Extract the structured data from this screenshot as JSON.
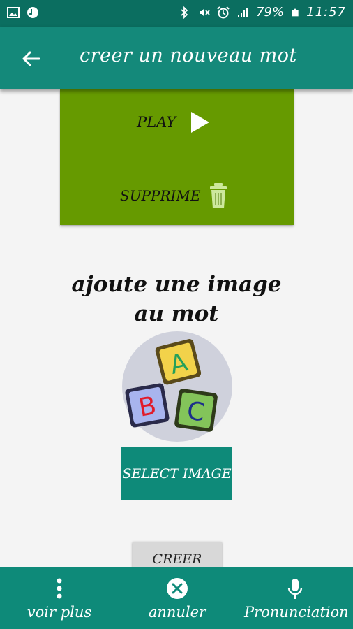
{
  "status_bar": {
    "battery": "79%",
    "time": "11:57"
  },
  "app_bar": {
    "title": "creer un nouveau mot"
  },
  "audio_card": {
    "play_label": "PLAY",
    "delete_label": "SUPPRIME"
  },
  "image_section": {
    "heading_line1": "ajoute une image",
    "heading_line2": "au mot",
    "image_letters": [
      "A",
      "B",
      "C"
    ],
    "select_button": "SELECT IMAGE"
  },
  "create_button": "CREER",
  "bottom_nav": {
    "items": [
      {
        "label": "voir plus",
        "icon": "more-vert-icon"
      },
      {
        "label": "annuler",
        "icon": "cancel-icon"
      },
      {
        "label": "Pronunciation",
        "icon": "microphone-icon"
      }
    ]
  },
  "colors": {
    "status_bar": "#0b6e60",
    "app_bar": "#14897a",
    "card_green": "#669a00",
    "accent_teal": "#0e8a79"
  }
}
